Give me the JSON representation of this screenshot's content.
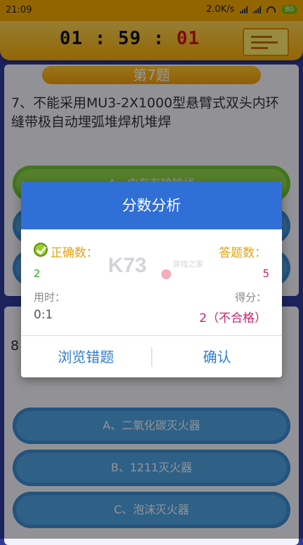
{
  "status": {
    "time": "21:09",
    "speed": "2.0K/s",
    "battery": "80"
  },
  "timer": {
    "hours": "01",
    "minutes": "59",
    "seconds": "01",
    "sep": ":"
  },
  "question": {
    "tag": "第7题",
    "text": "7、不能采用MU3-2X1000型悬臂式双头内环缝带极自动埋弧堆焊机堆焊",
    "option_a": "A、内有有输输线"
  },
  "question2": {
    "number": "8",
    "options": [
      "A、二氧化碳灭火器",
      "B、1211灭火器",
      "C、泡沫灭火器"
    ]
  },
  "dialog": {
    "title": "分数分析",
    "correct_label": "正确数：",
    "correct_value": "2",
    "answered_label": "答题数：",
    "answered_value": "5",
    "time_label": "用时：",
    "time_value": "0:1",
    "score_label": "得分：",
    "score_value": "2（不合格）",
    "review_button": "浏览错题",
    "confirm_button": "确认"
  },
  "watermark": {
    "logo": "K73",
    "text": "游戏之家"
  },
  "colors": {
    "header": "#2f6fd6",
    "accent": "#e3a21a",
    "correct": "#22aa22",
    "answered": "#cc2266",
    "button": "#2e7cd0"
  }
}
